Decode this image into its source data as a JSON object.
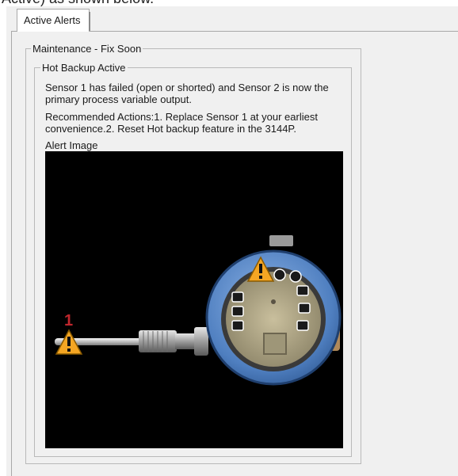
{
  "crop_caption": "Active) as shown below.",
  "tabs": [
    {
      "label": "Active Alerts"
    }
  ],
  "alert_group": {
    "category": "Maintenance - Fix Soon",
    "alert": {
      "title": "Hot Backup Active",
      "description": "Sensor 1 has failed (open or shorted) and Sensor 2 is now the primary process variable output.",
      "recommended_actions": "Recommended Actions:1. Replace Sensor 1 at your earliest convenience.2. Reset Hot backup feature in the 3144P.",
      "image_label": "Alert Image",
      "image": {
        "subject": "temperature-transmitter-with-sensor-probe",
        "callout_number": "1",
        "warning_color": "#f5a623",
        "callout_color": "#c0272d"
      }
    }
  }
}
